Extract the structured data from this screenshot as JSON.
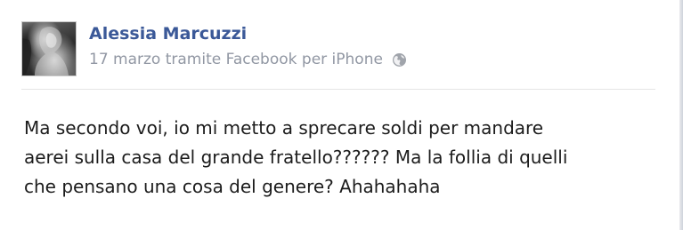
{
  "post": {
    "author_name": "Alessia Marcuzzi",
    "date": "17 marzo",
    "via_text": "tramite Facebook per iPhone",
    "privacy_icon": "globe-icon",
    "body_lines": [
      "Ma secondo voi, io mi metto a sprecare soldi per mandare",
      "aerei sulla casa del grande fratello?????? Ma la follia di quelli",
      "che pensano una cosa del genere? Ahahahaha"
    ]
  },
  "colors": {
    "name_link": "#3b5998",
    "meta_text": "#9197a3",
    "body_text": "#1c1c1c"
  }
}
